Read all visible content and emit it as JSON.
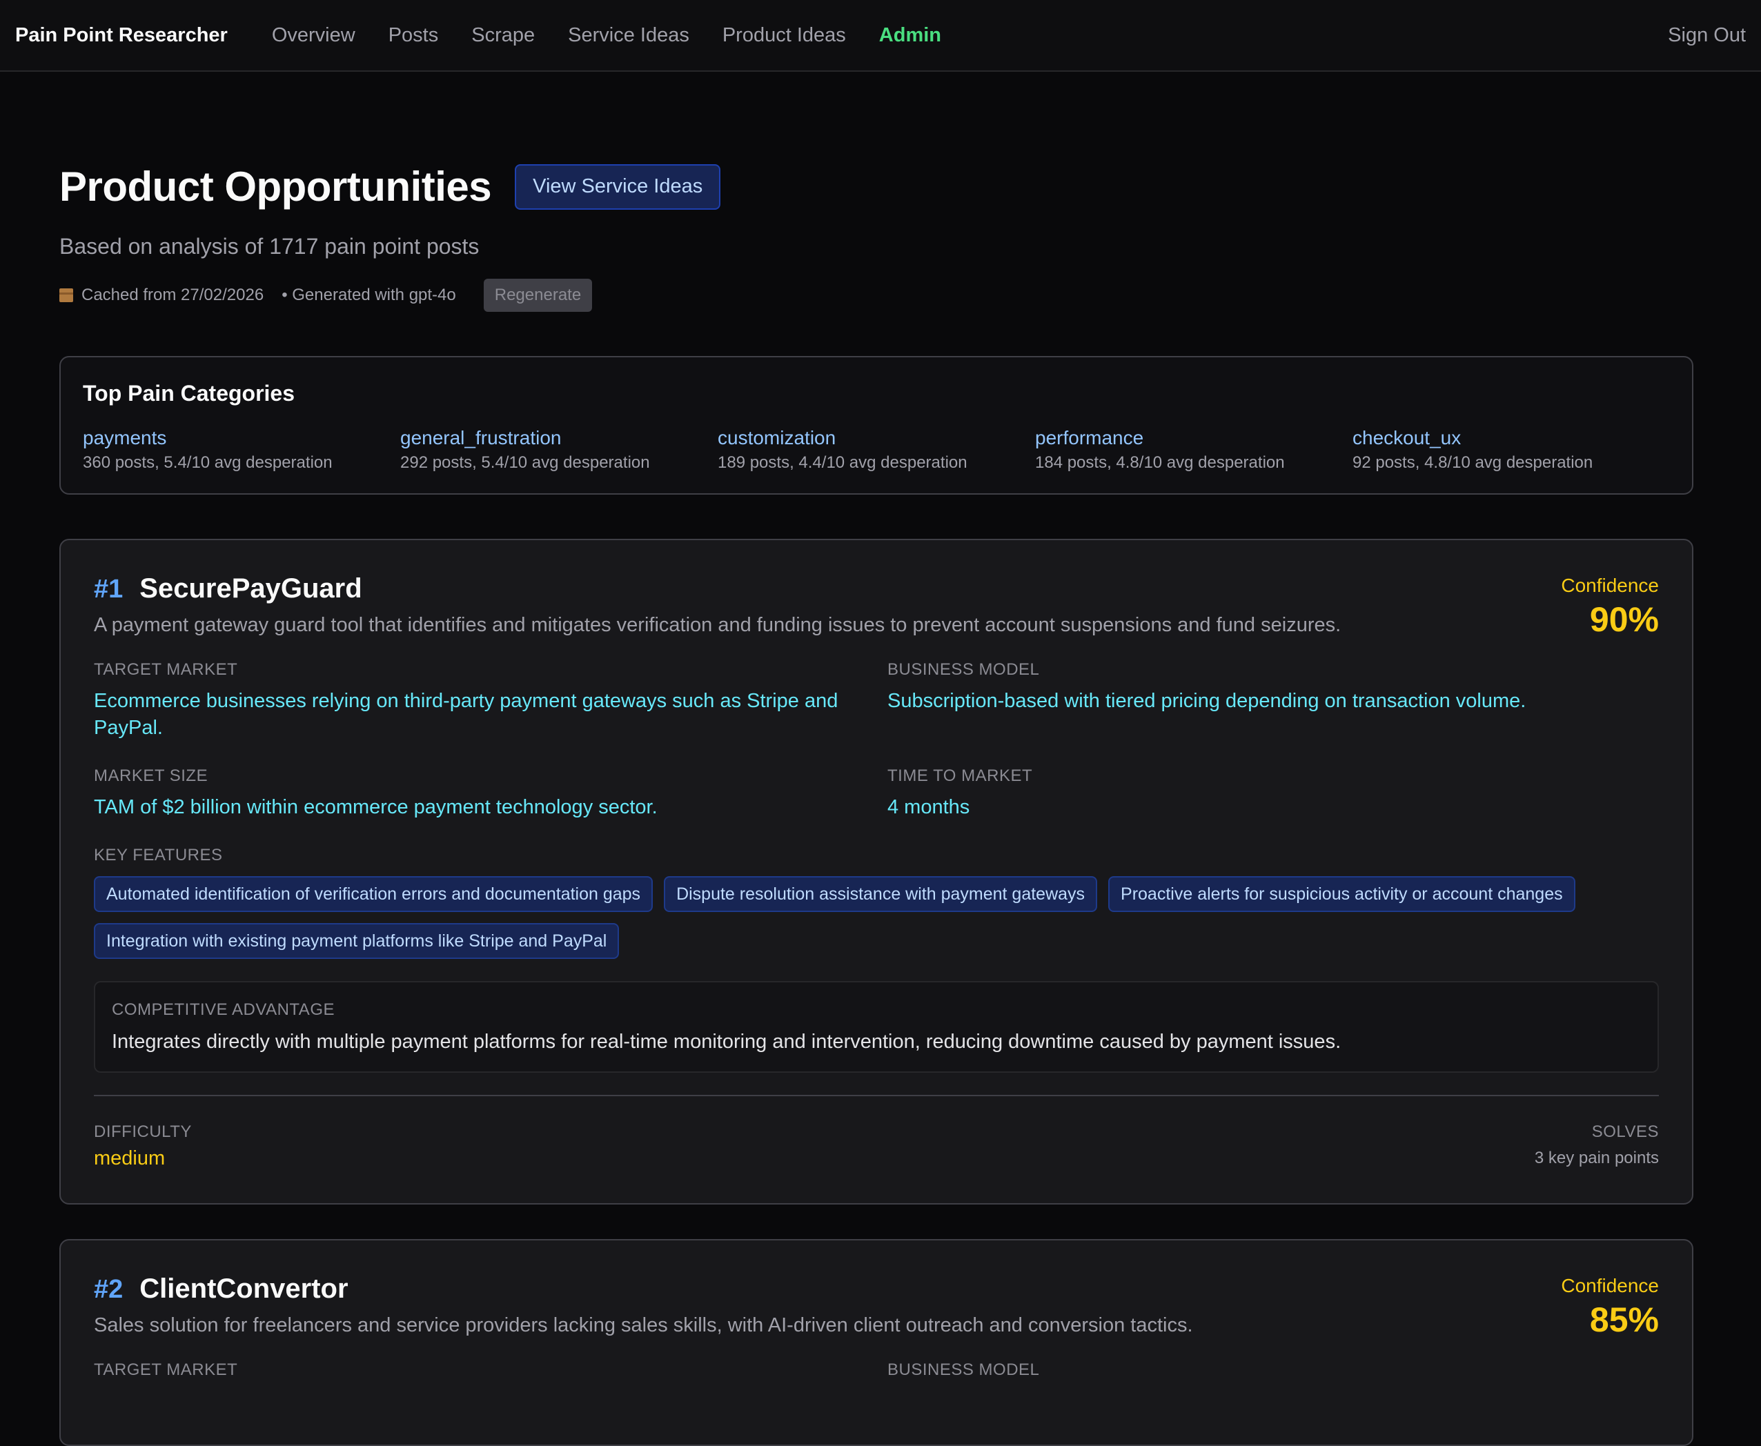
{
  "nav": {
    "brand": "Pain Point Researcher",
    "links": [
      "Overview",
      "Posts",
      "Scrape",
      "Service Ideas",
      "Product Ideas",
      "Admin"
    ],
    "active": "Admin",
    "sign_out": "Sign Out"
  },
  "header": {
    "title": "Product Opportunities",
    "view_service_button": "View Service Ideas",
    "subtitle": "Based on analysis of 1717 pain point posts",
    "cached": "Cached from 27/02/2026",
    "generated": "• Generated with gpt-4o",
    "regenerate_button": "Regenerate"
  },
  "categories": {
    "title": "Top Pain Categories",
    "items": [
      {
        "name": "payments",
        "stats": "360 posts, 5.4/10 avg desperation"
      },
      {
        "name": "general_frustration",
        "stats": "292 posts, 5.4/10 avg desperation"
      },
      {
        "name": "customization",
        "stats": "189 posts, 4.4/10 avg desperation"
      },
      {
        "name": "performance",
        "stats": "184 posts, 4.8/10 avg desperation"
      },
      {
        "name": "checkout_ux",
        "stats": "92 posts, 4.8/10 avg desperation"
      }
    ]
  },
  "labels": {
    "target_market": "Target Market",
    "business_model": "Business Model",
    "market_size": "Market Size",
    "time_to_market": "Time to Market",
    "key_features": "Key Features",
    "competitive_advantage": "Competitive Advantage",
    "difficulty": "Difficulty",
    "solves": "Solves",
    "confidence": "Confidence"
  },
  "products": [
    {
      "rank": "#1",
      "name": "SecurePayGuard",
      "description": "A payment gateway guard tool that identifies and mitigates verification and funding issues to prevent account suspensions and fund seizures.",
      "confidence": "90%",
      "target_market": "Ecommerce businesses relying on third-party payment gateways such as Stripe and PayPal.",
      "business_model": "Subscription-based with tiered pricing depending on transaction volume.",
      "market_size": "TAM of $2 billion within ecommerce payment technology sector.",
      "time_to_market": "4 months",
      "key_features": [
        "Automated identification of verification errors and documentation gaps",
        "Dispute resolution assistance with payment gateways",
        "Proactive alerts for suspicious activity or account changes",
        "Integration with existing payment platforms like Stripe and PayPal"
      ],
      "competitive_advantage": "Integrates directly with multiple payment platforms for real-time monitoring and intervention, reducing downtime caused by payment issues.",
      "difficulty": "medium",
      "solves": "3 key pain points"
    },
    {
      "rank": "#2",
      "name": "ClientConvertor",
      "description": "Sales solution for freelancers and service providers lacking sales skills, with AI-driven client outreach and conversion tactics.",
      "confidence": "85%"
    }
  ],
  "colors": {
    "background": "#09090b",
    "accent_blue": "#60a5fa",
    "accent_cyan": "#67e8f9",
    "accent_yellow": "#facc15",
    "admin_green": "#4ade80"
  }
}
